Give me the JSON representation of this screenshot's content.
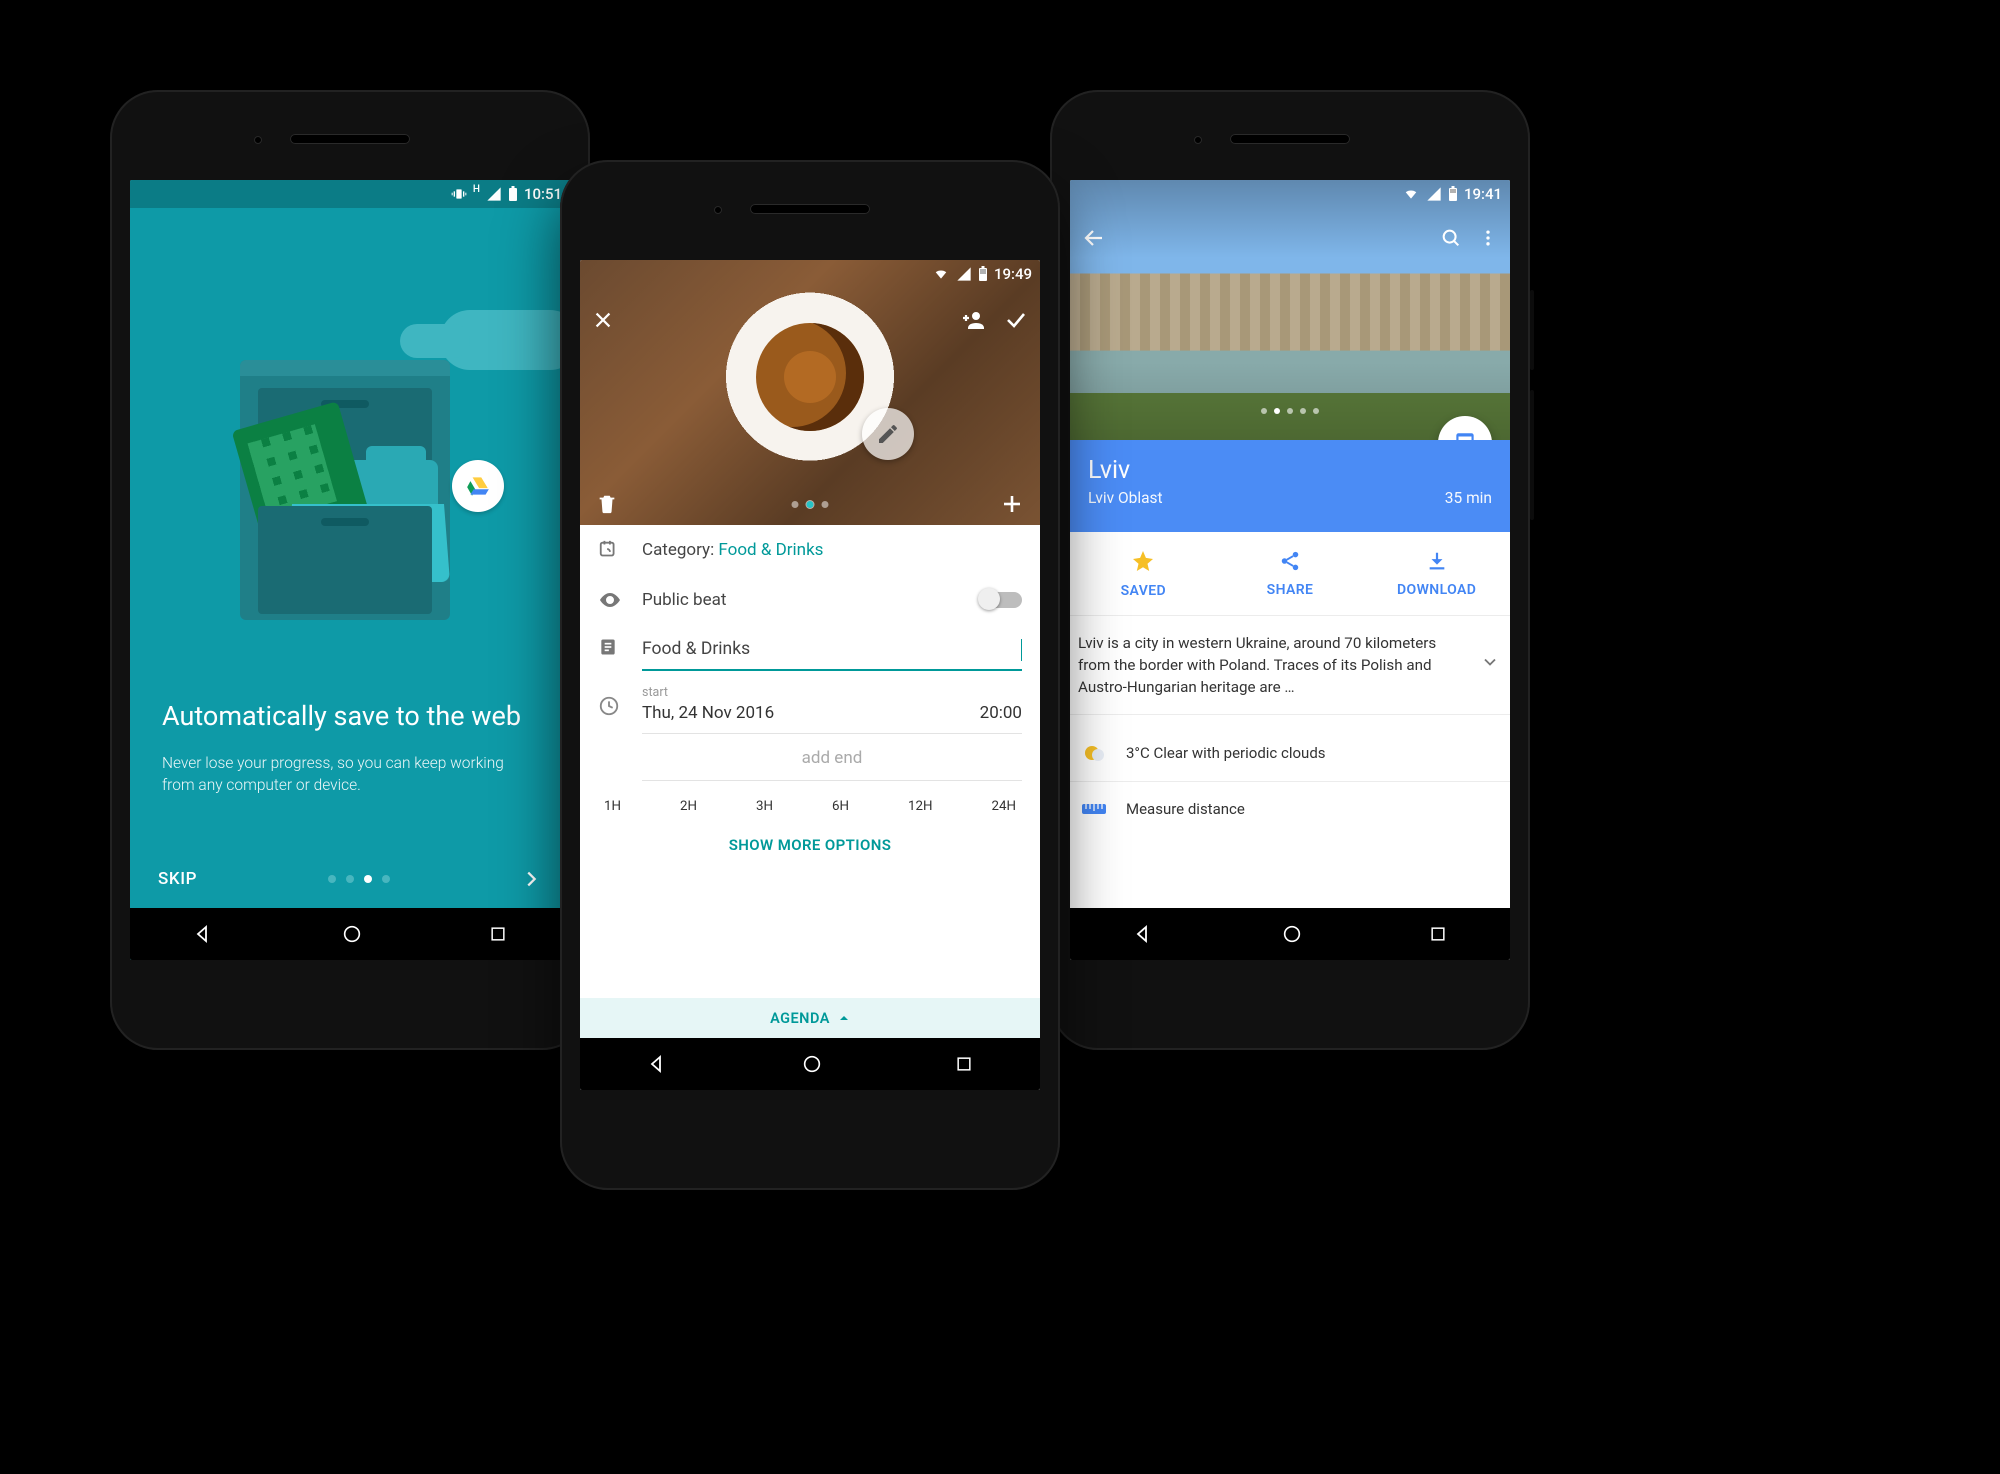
{
  "phones": {
    "sheets": {
      "status_time": "10:51",
      "drive_icon": "google-drive-icon",
      "title": "Automatically save to the web",
      "body": "Never lose your progress, so you can keep working from any computer or device.",
      "skip_label": "SKIP",
      "page_index": 2,
      "page_count": 4
    },
    "beat": {
      "status_time": "19:49",
      "category_label": "Category: ",
      "category_value": "Food & Drinks",
      "public_label": "Public beat",
      "public_on": false,
      "note_value": "Food & Drinks",
      "start_label": "start",
      "start_date": "Thu, 24 Nov 2016",
      "start_time": "20:00",
      "add_end_label": "add end",
      "durations": [
        "1H",
        "2H",
        "3H",
        "6H",
        "12H",
        "24H"
      ],
      "more_label": "SHOW MORE OPTIONS",
      "agenda_label": "AGENDA",
      "hero_page_index": 1,
      "hero_page_count": 3
    },
    "maps": {
      "status_time": "19:41",
      "place_title": "Lviv",
      "place_subtitle": "Lviv Oblast",
      "travel_time": "35 min",
      "hero_page_index": 1,
      "hero_page_count": 5,
      "actions": {
        "saved": "SAVED",
        "share": "SHARE",
        "download": "DOWNLOAD"
      },
      "description": "Lviv is a city in western Ukraine, around 70 kilometers from the border with Poland. Traces of its Polish and Austro-Hungarian heritage are …",
      "weather": "3°C Clear with periodic clouds",
      "measure_label": "Measure distance"
    }
  }
}
